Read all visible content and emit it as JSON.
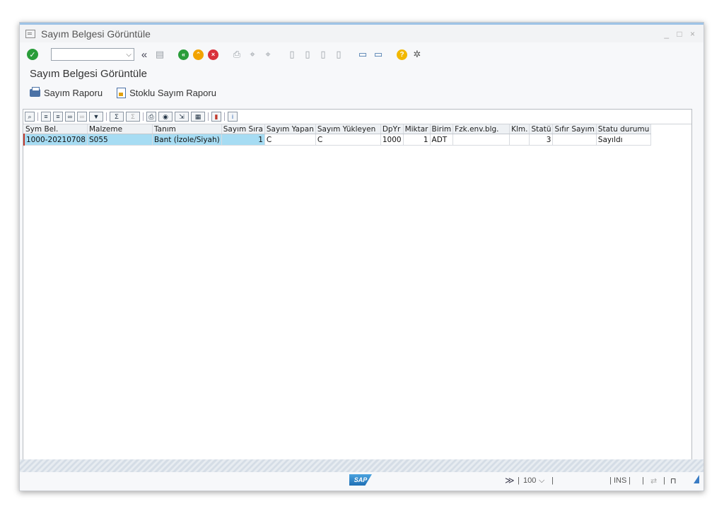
{
  "window": {
    "title": "Sayım Belgesi Görüntüle",
    "controls": "_ □ ×"
  },
  "toolbar": {
    "command_value": "",
    "dropdown_glyph": "⌵"
  },
  "screen": {
    "title": "Sayım Belgesi Görüntüle"
  },
  "app_toolbar": {
    "btn1": "Sayım Raporu",
    "btn2": "Stoklu Sayım Raporu"
  },
  "grid": {
    "columns": [
      "Sym Bel.",
      "Malzeme",
      "Tanım",
      "Sayım Sıra",
      "Sayım Yapan",
      "Sayım Yükleyen",
      "DpYr",
      "Miktar",
      "Birim",
      "Fzk.env.blg.",
      "Klm.",
      "Statü",
      "Sıfır Sayım",
      "Statu durumu"
    ],
    "rows": [
      [
        "1000-20210708",
        "S055",
        "Bant (İzole/Siyah)",
        "1",
        "C",
        "C",
        "1000",
        "1",
        "ADT",
        "",
        "",
        "3",
        "",
        "Sayıldı"
      ]
    ]
  },
  "status": {
    "nav": "≫",
    "zoom": "100",
    "zoom_arrow": "⌵",
    "ins": "INS"
  }
}
